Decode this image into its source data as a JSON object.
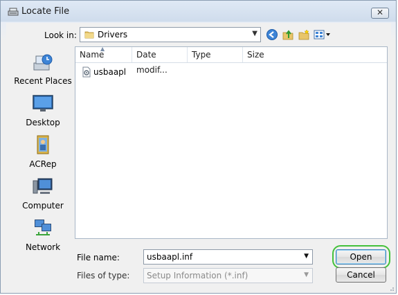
{
  "window": {
    "title": "Locate File"
  },
  "toolbar": {
    "lookin_label": "Look in:",
    "lookin_value": "Drivers",
    "icons": [
      "back-icon",
      "up-folder-icon",
      "new-folder-icon",
      "views-menu-icon"
    ]
  },
  "sidebar": {
    "places": [
      {
        "label": "Recent Places",
        "icon": "recent-places-icon"
      },
      {
        "label": "Desktop",
        "icon": "desktop-icon"
      },
      {
        "label": "ACRep",
        "icon": "user-folder-icon"
      },
      {
        "label": "Computer",
        "icon": "computer-icon"
      },
      {
        "label": "Network",
        "icon": "network-icon"
      }
    ]
  },
  "filelist": {
    "columns": [
      "Name",
      "Date modif...",
      "Type",
      "Size"
    ],
    "files": [
      {
        "name": "usbaapl",
        "icon": "setup-info-file-icon"
      }
    ]
  },
  "bottom": {
    "filename_label": "File name:",
    "filename_value": "usbaapl.inf",
    "filetype_label": "Files of type:",
    "filetype_value": "Setup Information (*.inf)",
    "open_label": "Open",
    "cancel_label": "Cancel"
  },
  "colors": {
    "highlight": "#44c13a",
    "accent": "#3c7fb1"
  }
}
